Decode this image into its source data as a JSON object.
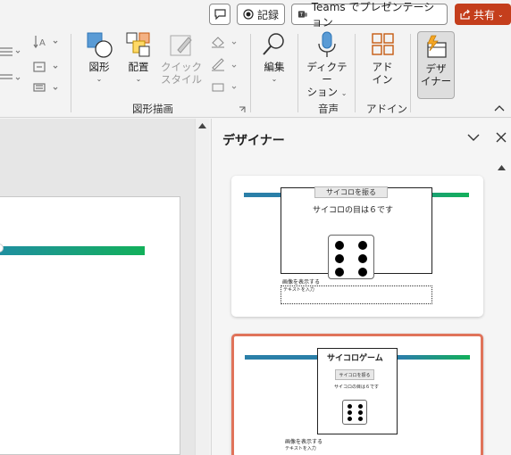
{
  "titlebar": {
    "comment_icon": "comment-icon",
    "record_label": "記録",
    "teams_label": "Teams でプレゼンテーション",
    "share_label": "共有"
  },
  "ribbon": {
    "shapes_label": "図形",
    "arrange_label": "配置",
    "quick_styles_line1": "クイック",
    "quick_styles_line2": "スタイル",
    "drawing_group_label": "図形描画",
    "editing_label": "編集",
    "dictate_line1": "ディクテー",
    "dictate_line2": "ション",
    "voice_group_label": "音声",
    "addins_line1": "アド",
    "addins_line2": "イン",
    "addins_group_label": "アドイン",
    "designer_line1": "デザ",
    "designer_line2": "イナー"
  },
  "designer": {
    "title": "デザイナー",
    "card1": {
      "button_label": "サイコロを振る",
      "result_text": "サイコロの目は６です",
      "image_label": "画像を表示する",
      "placeholder_text": "テキストを入力"
    },
    "card2": {
      "title": "サイコロゲーム",
      "button_label": "サイコロを振る",
      "result_text": "サイコロの目は６です",
      "image_label": "画像を表示する",
      "placeholder_text": "テキストを入力"
    }
  },
  "colors": {
    "accent_red": "#c43e1c",
    "selected_border": "#e0735a",
    "bar_blue": "#2a7fa8",
    "bar_green": "#12b05a"
  }
}
